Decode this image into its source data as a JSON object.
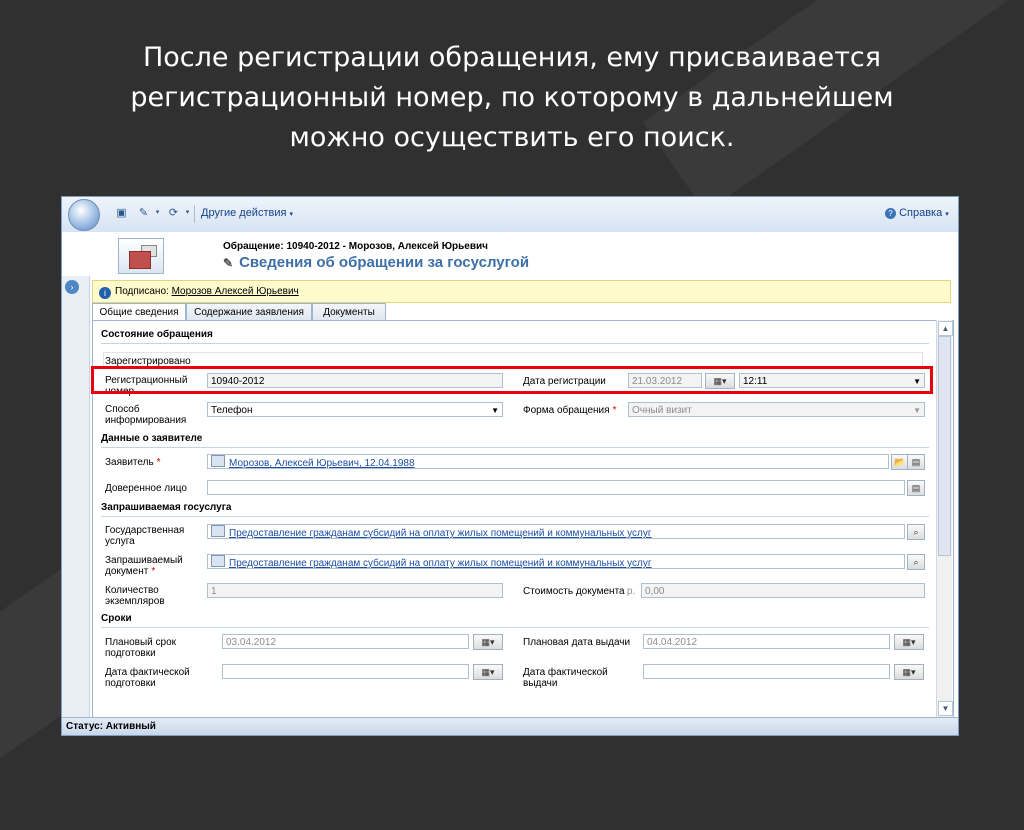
{
  "slide": {
    "title_lines": [
      "После регистрации обращения, ему присваивается",
      "регистрационный номер, по которому в дальнейшем",
      "можно осуществить его поиск."
    ]
  },
  "toolbar": {
    "other_actions": "Другие действия",
    "help": "Справка"
  },
  "header": {
    "subtitle": "Обращение: 10940-2012 - Морозов, Алексей Юрьевич",
    "title": "Сведения об обращении за госуслугой"
  },
  "notice": {
    "prefix": "Подписано: ",
    "signer": "Морозов Алексей Юрьевич"
  },
  "tabs": [
    {
      "label": "Общие сведения"
    },
    {
      "label": "Содержание заявления"
    },
    {
      "label": "Документы"
    }
  ],
  "sections": {
    "status": "Состояние обращения",
    "applicant": "Данные о заявителе",
    "service": "Запрашиваемая госуслуга",
    "terms": "Сроки"
  },
  "fields": {
    "registered_label": "Зарегистрировано",
    "reg_number_label": "Регистрационный номер",
    "reg_number_value": "10940-2012",
    "reg_date_label": "Дата регистрации",
    "reg_date_value": "21.03.2012",
    "reg_time_value": "12:11",
    "info_method_label": "Способ информирования",
    "info_method_value": "Телефон",
    "form_label": "Форма обращения",
    "form_value": "Очный визит",
    "applicant_label": "Заявитель",
    "applicant_value": "Морозов, Алексей Юрьевич, 12.04.1988",
    "trusted_label": "Доверенное лицо",
    "gov_service_label": "Государственная услуга",
    "gov_service_value": "Предоставление гражданам субсидий на оплату жилых помещений и коммунальных услуг",
    "requested_doc_label": "Запрашиваемый документ",
    "requested_doc_value": "Предоставление гражданам субсидий на оплату жилых помещений и коммунальных услуг",
    "copies_label": "Количество экземпляров",
    "copies_value": "1",
    "doc_cost_label": "Стоимость документа",
    "currency": "р.",
    "doc_cost_value": "0,00",
    "planned_prep_label": "Плановый срок подготовки",
    "planned_prep_value": "03.04.2012",
    "planned_issue_label": "Плановая дата выдачи",
    "planned_issue_value": "04.04.2012",
    "actual_prep_label": "Дата фактической подготовки",
    "actual_issue_label": "Дата фактической выдачи"
  },
  "status_bar": "Статус: Активный",
  "colors": {
    "highlight": "#e8000b",
    "title_blue": "#3d6fa8",
    "link_blue": "#1f4fa3"
  }
}
